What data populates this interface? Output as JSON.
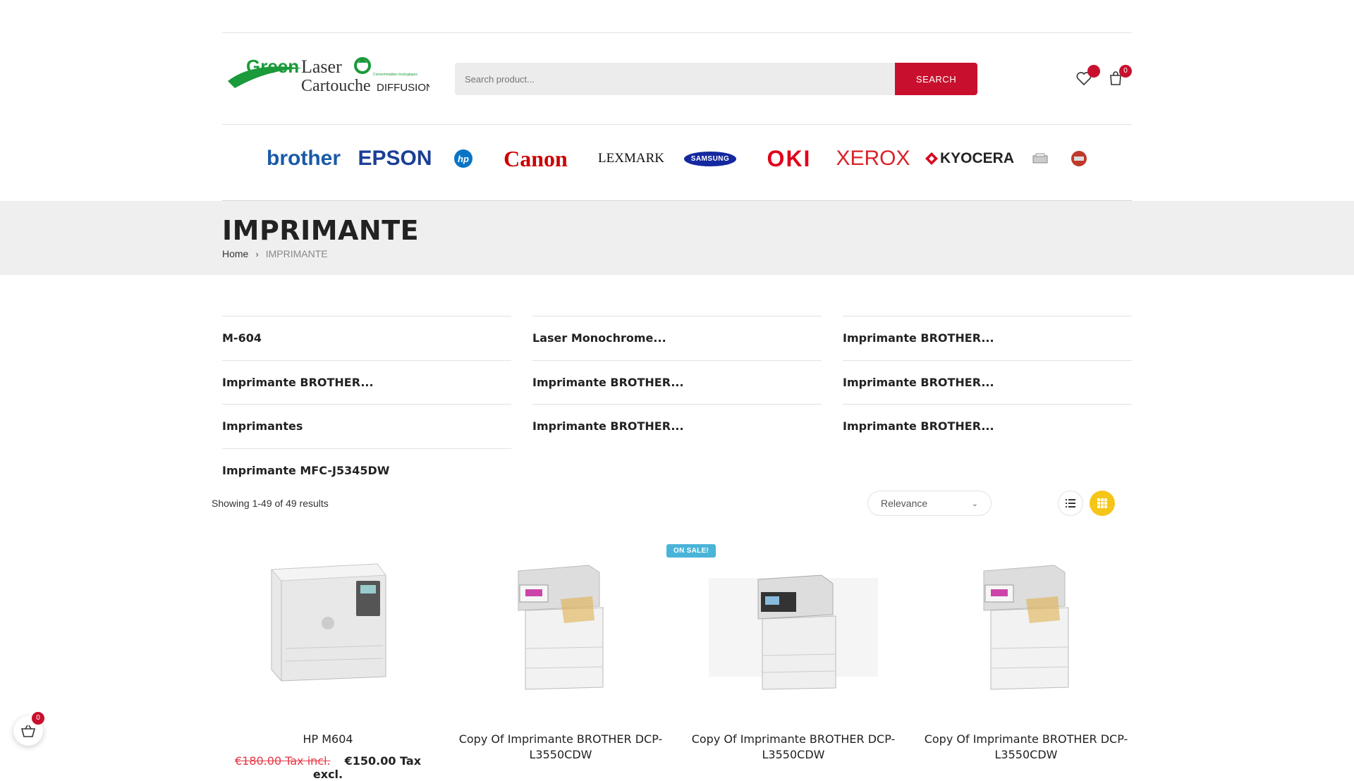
{
  "header": {
    "logo_text_1": "Green",
    "logo_text_2": "Laser",
    "logo_text_3": "Cartouche",
    "logo_text_4": "DIFFUSION",
    "logo_tagline": "Consommables écologiques",
    "search_placeholder": "Search product...",
    "search_button": "SEARCH",
    "wishlist_count": "",
    "cart_count": "0"
  },
  "brands": [
    "brother",
    "EPSON",
    "hp",
    "Canon",
    "LEXMARK",
    "SAMSUNG",
    "OKI",
    "XEROX",
    "KYOCERA"
  ],
  "page": {
    "title": "IMPRIMANTE",
    "breadcrumb_home": "Home",
    "breadcrumb_current": "IMPRIMANTE"
  },
  "subcategories": [
    "M-604",
    "Laser Monochrome...",
    "Imprimante BROTHER...",
    "Imprimante BROTHER...",
    "Imprimante BROTHER...",
    "Imprimante BROTHER...",
    "Imprimantes",
    "Imprimante BROTHER...",
    "Imprimante BROTHER...",
    "Imprimante MFC-J5345DW"
  ],
  "toolbar": {
    "showing": "Showing 1-49 of 49 results",
    "sort_value": "Relevance"
  },
  "products": [
    {
      "name_1": "HP M604",
      "name_2": "",
      "old_price": "€180.00 Tax incl.",
      "price": "€150.00 Tax excl.",
      "sale": ""
    },
    {
      "name_1": "Copy Of Imprimante BROTHER DCP-",
      "name_2": "L3550CDW",
      "old_price": "",
      "price": "",
      "sale": ""
    },
    {
      "name_1": "Copy Of Imprimante BROTHER DCP-",
      "name_2": "L3550CDW",
      "old_price": "",
      "price": "",
      "sale": "ON SALE!"
    },
    {
      "name_1": "Copy Of Imprimante BROTHER DCP-",
      "name_2": "L3550CDW",
      "old_price": "",
      "price": "",
      "sale": ""
    }
  ],
  "floating_cart": {
    "count": "0"
  },
  "colors": {
    "accent": "#c8102e",
    "grid_active": "#f5c518",
    "sale_badge": "#4ab4d8"
  }
}
